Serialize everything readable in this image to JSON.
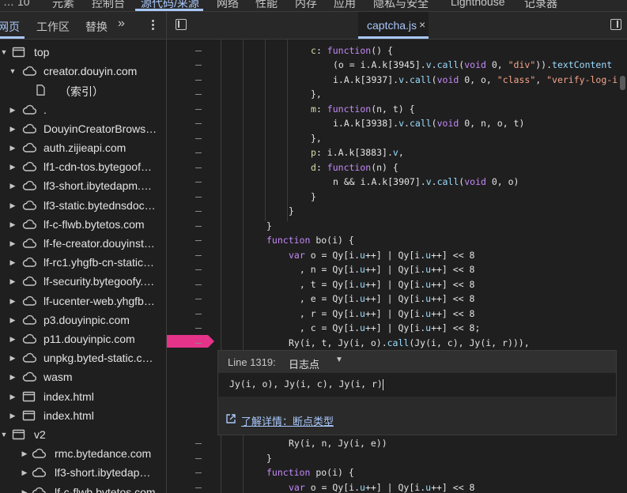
{
  "top_tabs": [
    "…",
    "10",
    "元素",
    "控制台",
    "源代码/来源",
    "网络",
    "性能",
    "内存",
    "应用",
    "隐私与安全",
    "Lighthouse",
    "记录器"
  ],
  "active_top_tab": "源代码/来源",
  "left_panel": {
    "tabs": [
      "网页",
      "工作区",
      "替换",
      "»"
    ],
    "tree": [
      {
        "label": "top",
        "depth": 0,
        "expanded": true,
        "icon": "frame-icon"
      },
      {
        "label": "creator.douyin.com",
        "depth": 1,
        "expanded": true,
        "icon": "cloud-icon"
      },
      {
        "label": "（索引）",
        "depth": 2,
        "expanded": null,
        "icon": "file-icon"
      },
      {
        "label": ".",
        "depth": 1,
        "expanded": false,
        "icon": "cloud-icon"
      },
      {
        "label": "DouyinCreatorBrows…",
        "depth": 1,
        "expanded": false,
        "icon": "cloud-icon"
      },
      {
        "label": "auth.zijieapi.com",
        "depth": 1,
        "expanded": false,
        "icon": "cloud-icon"
      },
      {
        "label": "lf1-cdn-tos.bytegoof…",
        "depth": 1,
        "expanded": false,
        "icon": "cloud-icon"
      },
      {
        "label": "lf3-short.ibytedapm.…",
        "depth": 1,
        "expanded": false,
        "icon": "cloud-icon"
      },
      {
        "label": "lf3-static.bytednsdoc…",
        "depth": 1,
        "expanded": false,
        "icon": "cloud-icon"
      },
      {
        "label": "lf-c-flwb.bytetos.com",
        "depth": 1,
        "expanded": false,
        "icon": "cloud-icon"
      },
      {
        "label": "lf-fe-creator.douyinst…",
        "depth": 1,
        "expanded": false,
        "icon": "cloud-icon"
      },
      {
        "label": "lf-rc1.yhgfb-cn-static…",
        "depth": 1,
        "expanded": false,
        "icon": "cloud-icon"
      },
      {
        "label": "lf-security.bytegoofy.…",
        "depth": 1,
        "expanded": false,
        "icon": "cloud-icon"
      },
      {
        "label": "lf-ucenter-web.yhgfb…",
        "depth": 1,
        "expanded": false,
        "icon": "cloud-icon"
      },
      {
        "label": "p3.douyinpic.com",
        "depth": 1,
        "expanded": false,
        "icon": "cloud-icon"
      },
      {
        "label": "p11.douyinpic.com",
        "depth": 1,
        "expanded": false,
        "icon": "cloud-icon"
      },
      {
        "label": "unpkg.byted-static.c…",
        "depth": 1,
        "expanded": false,
        "icon": "cloud-icon"
      },
      {
        "label": "wasm",
        "depth": 1,
        "expanded": false,
        "icon": "cloud-icon"
      },
      {
        "label": "index.html",
        "depth": 1,
        "expanded": false,
        "icon": "frame-icon"
      },
      {
        "label": "index.html",
        "depth": 1,
        "expanded": false,
        "icon": "frame-icon"
      },
      {
        "label": "v2",
        "depth": 0,
        "expanded": true,
        "icon": "frame-icon"
      },
      {
        "label": "rmc.bytedance.com",
        "depth": 1,
        "expanded": false,
        "icon": "cloud-icon"
      },
      {
        "label": "lf3-short.ibytedap…",
        "depth": 1,
        "expanded": false,
        "icon": "cloud-icon"
      },
      {
        "label": "lf-c-flwb.bytetos.com",
        "depth": 1,
        "expanded": false,
        "icon": "cloud-icon"
      }
    ]
  },
  "editor": {
    "file_tab": "captcha.js",
    "close_glyph": "×",
    "code_top": [
      [
        0,
        "  "
      ],
      [
        1,
        "c: function() {"
      ],
      [
        2,
        "(o = i.A.k[3945].v.call(void 0, \"div\")).textContent"
      ],
      [
        2,
        "i.A.k[3937].v.call(void 0, o, \"class\", \"verify-log-i"
      ],
      [
        1,
        "},"
      ],
      [
        1,
        "m: function(n, t) {"
      ],
      [
        2,
        "i.A.k[3938].v.call(void 0, n, o, t)"
      ],
      [
        1,
        "},"
      ],
      [
        1,
        "p: i.A.k[3883].v,"
      ],
      [
        1,
        "d: function(n) {"
      ],
      [
        2,
        "n && i.A.k[3907].v.call(void 0, o)"
      ],
      [
        1,
        "}"
      ],
      [
        0,
        "}"
      ],
      [
        -1,
        "}"
      ],
      [
        -1,
        "function bo(i) {"
      ],
      [
        0,
        "var o = Qy[i.u++] | Qy[i.u++] << 8"
      ],
      [
        0,
        "  , n = Qy[i.u++] | Qy[i.u++] << 8"
      ],
      [
        0,
        "  , t = Qy[i.u++] | Qy[i.u++] << 8"
      ],
      [
        0,
        "  , e = Qy[i.u++] | Qy[i.u++] << 8"
      ],
      [
        0,
        "  , r = Qy[i.u++] | Qy[i.u++] << 8"
      ],
      [
        0,
        "  , c = Qy[i.u++] | Qy[i.u++] << 8;"
      ],
      [
        0,
        "Ry(i, t, Jy(i, o).call(Jy(i, c), Jy(i, r))),"
      ]
    ],
    "code_bottom": [
      [
        0,
        "Ry(i, n, Jy(i, e))"
      ],
      [
        -1,
        "}"
      ],
      [
        -1,
        "function po(i) {"
      ],
      [
        0,
        "var o = Qy[i.u++] | Qy[i.u++] << 8"
      ]
    ]
  },
  "breakpoint_popup": {
    "line_label": "Line 1319:",
    "type_label": "日志点",
    "expression": "Jy(i, o), Jy(i, c), Jy(i, r)",
    "learn_more": "了解详情：断点类型"
  }
}
